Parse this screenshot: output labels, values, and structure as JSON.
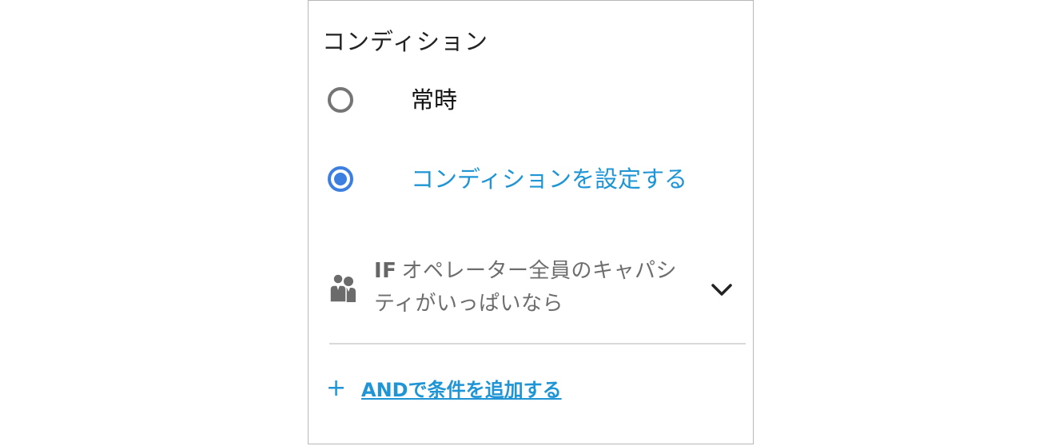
{
  "section": {
    "title": "コンディション"
  },
  "radios": [
    {
      "label": "常時",
      "selected": false
    },
    {
      "label": "コンディションを設定する",
      "selected": true
    }
  ],
  "condition": {
    "icon": "operators-icon",
    "prefix": "IF",
    "text": "オペレーター全員のキャパシティがいっぱいなら",
    "expand_icon": "chevron-down-icon"
  },
  "add_condition": {
    "icon": "plus-icon",
    "plus_glyph": "+",
    "label": "ANDで条件を追加する"
  },
  "colors": {
    "accent": "#1f95d6",
    "radio_selected": "#3d7fe0",
    "radio_unselected": "#757575",
    "muted_text": "#6d6d6d",
    "divider": "#d9d9d9",
    "panel_border": "#b8b8b8"
  }
}
